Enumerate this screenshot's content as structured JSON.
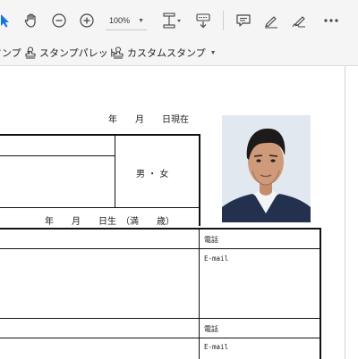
{
  "toolbar": {
    "zoom": "100%",
    "tools": [
      "select-arrow",
      "hand",
      "zoom-out",
      "zoom-in",
      "page-fit",
      "scroll-mode",
      "comment",
      "highlight",
      "sign",
      "more"
    ]
  },
  "stampbar": {
    "stamp_label": "スタンプ",
    "stamp_palette_label": "スタンプパレット",
    "custom_stamp_label": "カスタムスタンプ"
  },
  "document": {
    "date_header": "年　　月　　日現在",
    "gender": "男 ・ 女",
    "birth_line": "年　　月　　日生　（満　　歳）",
    "phone_label_1": "電話",
    "email_label_1": "E-mail",
    "phone_label_2": "電話",
    "email_label_2": "E-mail"
  },
  "colors": {
    "accent": "#1473e6",
    "photo_bg": "#dfe6ee"
  }
}
